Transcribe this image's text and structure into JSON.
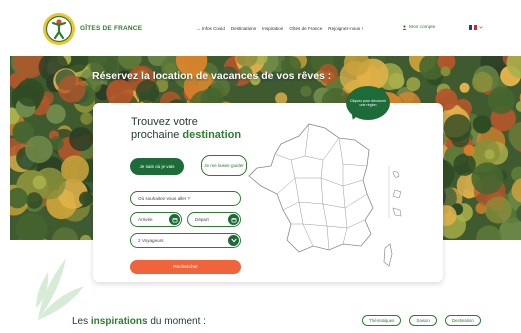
{
  "header": {
    "brand": "GÎTES DE FRANCE",
    "nav": [
      "→ Infos Covid",
      "Destinations",
      "Inspiration",
      "Gîtes de France",
      "Rejoignez-nous !"
    ],
    "account": "Mon compte",
    "lang_icon": "chevron-down-icon"
  },
  "hero": {
    "title": "Réservez la location de vacances de vos rêves :"
  },
  "search": {
    "title_line1": "Trouvez votre",
    "title_line2_prefix": "prochaine",
    "title_line2_accent": "destination",
    "primary_tab": "Je sais où je vais",
    "secondary_tab": "Je me laisse guider",
    "where_placeholder": "Où souhaitez-vous aller ?",
    "arrive_label": "Arrivée",
    "depart_label": "Départ",
    "travellers": "2 Voyageurs",
    "submit": "Rechercher"
  },
  "map": {
    "bubble": "Cliquez pour découvrir une région"
  },
  "inspirations": {
    "prefix": "Les",
    "accent": "inspirations",
    "suffix": "du moment :",
    "filters": [
      "Thématiques",
      "Saison",
      "Destination"
    ]
  },
  "colors": {
    "brand_green": "#2f7d32",
    "dark_green": "#1e6b3a",
    "cta_orange": "#f0643c"
  }
}
